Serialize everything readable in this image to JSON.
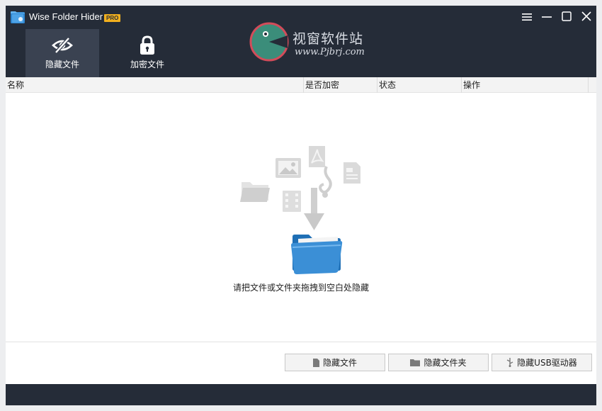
{
  "app": {
    "title": "Wise Folder Hider",
    "badge": "PRO",
    "icon": "folder-logo-icon"
  },
  "window_controls": [
    "menu-icon",
    "minimize-icon",
    "maximize-icon",
    "close-icon"
  ],
  "tabs": [
    {
      "label": "隐藏文件",
      "icon": "eye-slash-icon",
      "active": true
    },
    {
      "label": "加密文件",
      "icon": "lock-icon",
      "active": false
    }
  ],
  "watermark": {
    "title": "视窗软件站",
    "url": "www.Pjbrj.com"
  },
  "table": {
    "columns": [
      "名称",
      "是否加密",
      "状态",
      "操作"
    ],
    "rows": []
  },
  "empty_state": {
    "message": "请把文件或文件夹拖拽到空白处隐藏",
    "icons": [
      "folder-icon",
      "image-icon",
      "pdf-icon",
      "music-icon",
      "document-icon",
      "film-icon",
      "arrow-down-icon",
      "blue-folder-icon"
    ]
  },
  "buttons": {
    "hide_file": "隐藏文件",
    "hide_folder": "隐藏文件夹",
    "hide_usb": "隐藏USB驱动器"
  },
  "colors": {
    "header_bg": "#252c38",
    "active_tab_bg": "#3a4251",
    "badge": "#f2b01e",
    "folder_blue": "#3b8fd6"
  }
}
